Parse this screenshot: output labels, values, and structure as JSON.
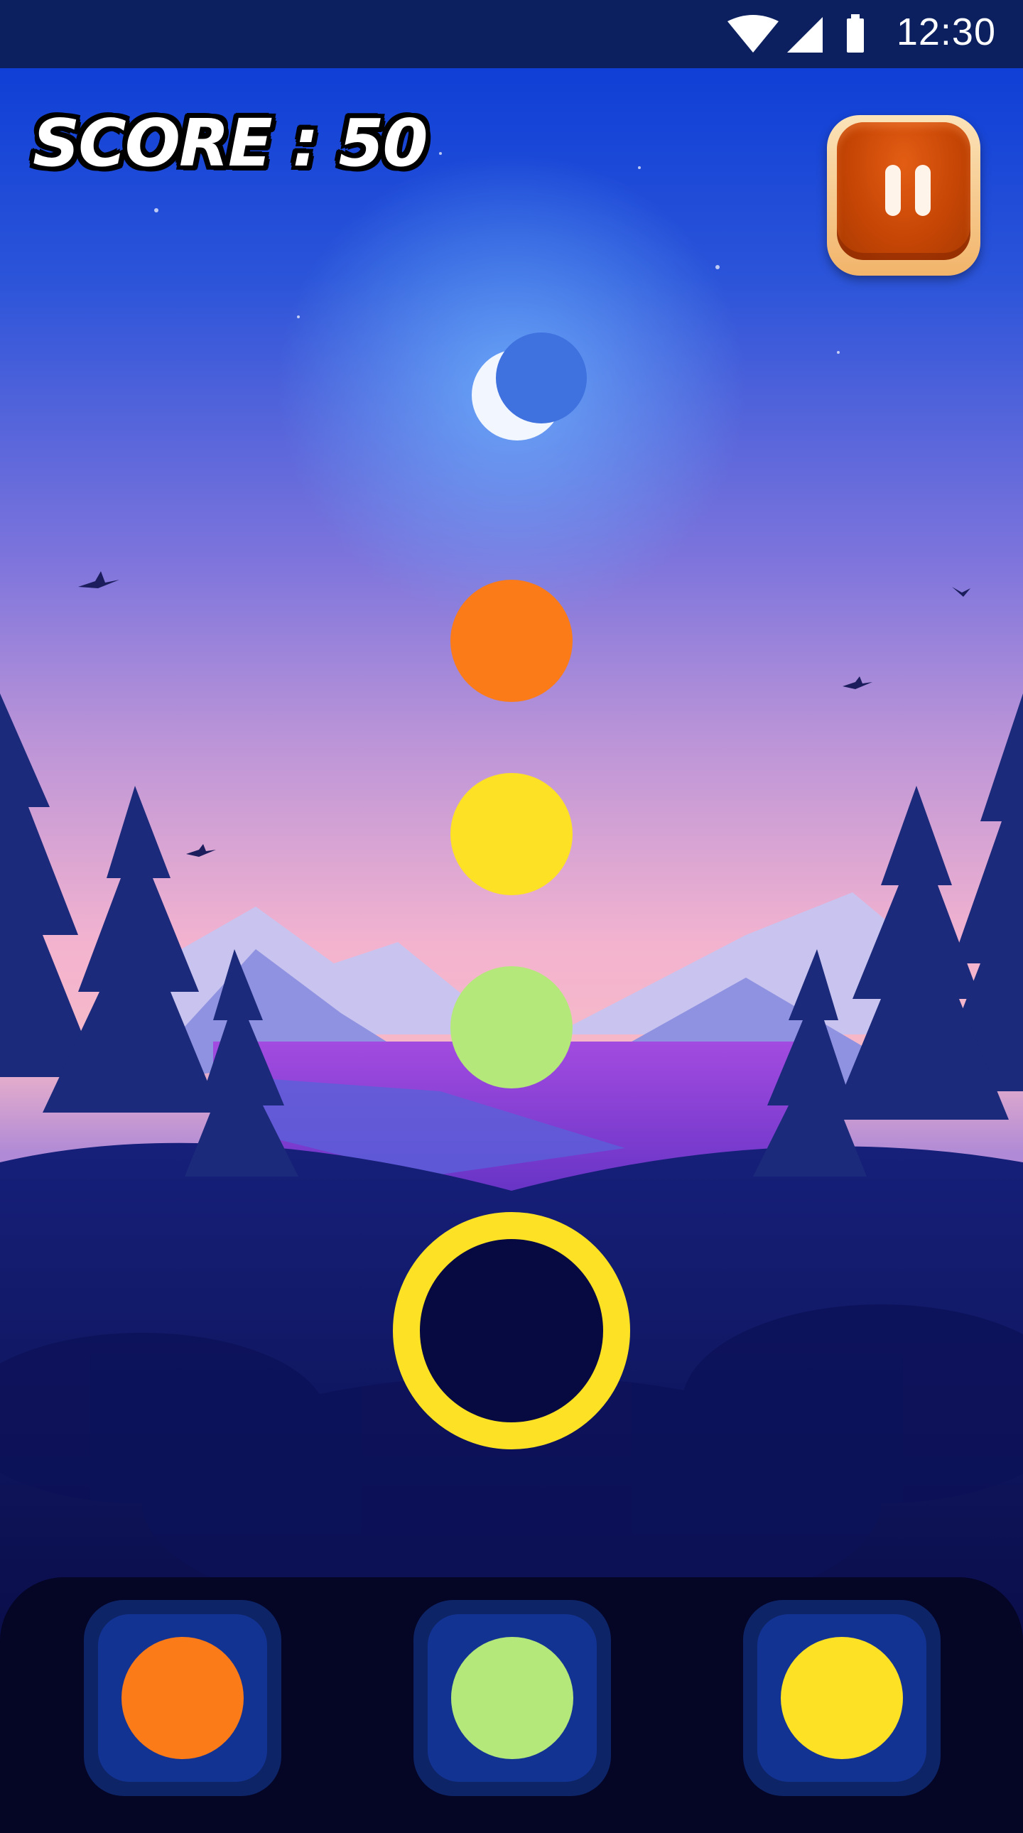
{
  "status_bar": {
    "time": "12:30",
    "icons": [
      "wifi-icon",
      "signal-icon",
      "battery-icon"
    ]
  },
  "hud": {
    "score_text": "SCORE : 50"
  },
  "colors": {
    "orange": "#fa7b17",
    "yellow": "#fde125",
    "green": "#b4e87a",
    "pause_button": "#c74605",
    "ring": "#fde125"
  },
  "falling_sequence": [
    "orange",
    "yellow",
    "green"
  ],
  "target_ring_color": "yellow",
  "palette_buttons": [
    "orange",
    "green",
    "yellow"
  ]
}
